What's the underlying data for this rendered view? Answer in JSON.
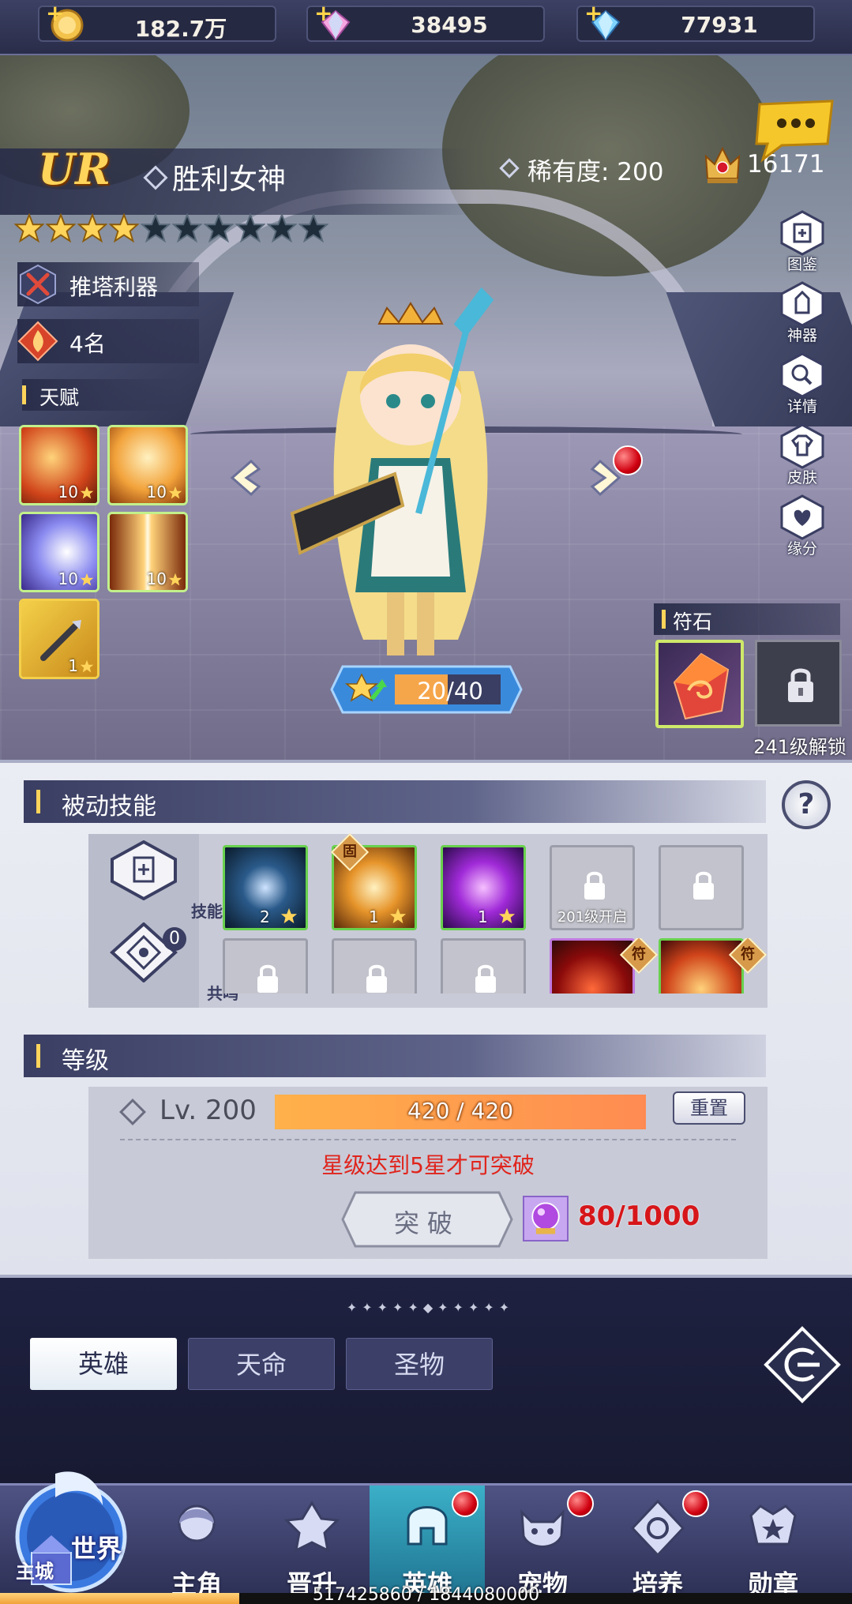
{
  "currency": {
    "gold": "182.7万",
    "gems_pink": "38495",
    "gems_blue": "77931"
  },
  "hero": {
    "grade": "UR",
    "name": "胜利女神",
    "rarity_label": "稀有度: 200",
    "power": "16171",
    "stars_filled": 4,
    "stars_total": 10,
    "role_tag": "推塔利器",
    "rank_tag": "4名"
  },
  "talent": {
    "title": "天赋",
    "items": [
      {
        "level": "10"
      },
      {
        "level": "10"
      },
      {
        "level": "10"
      },
      {
        "level": "10"
      },
      {
        "level": "1"
      }
    ]
  },
  "side_menu": [
    "图鉴",
    "神器",
    "详情",
    "皮肤",
    "缘分"
  ],
  "exp_pill": "20/40",
  "rune": {
    "title": "符石",
    "unlock_text": "241级解锁"
  },
  "passive": {
    "title": "被动技能",
    "help": "?",
    "codex_label": "技能图鉴",
    "resonance_label": "共鸣",
    "resonance_count": "0",
    "row1": [
      {
        "level": "2"
      },
      {
        "level": "1",
        "tag": "固"
      },
      {
        "level": "1"
      },
      {
        "unlock": "201级开启"
      },
      {
        "locked": true
      }
    ],
    "row2_tags": [
      "符",
      "符"
    ]
  },
  "level": {
    "title": "等级",
    "label": "Lv. 200",
    "xp": "420 / 420",
    "xp_fraction": 1.0,
    "reset": "重置",
    "hint": "星级达到5星才可突破",
    "break_button": "突破",
    "break_cost": "80/1000"
  },
  "tabs": {
    "hero": "英雄",
    "destiny": "天命",
    "relic": "圣物"
  },
  "nav": {
    "world": "世界",
    "city": "主城",
    "items": [
      {
        "label": "主角",
        "dot": false
      },
      {
        "label": "晋升",
        "dot": false
      },
      {
        "label": "英雄",
        "dot": true
      },
      {
        "label": "宠物",
        "dot": true
      },
      {
        "label": "培养",
        "dot": true
      },
      {
        "label": "勋章",
        "dot": false
      }
    ]
  },
  "account_exp": {
    "text": "517425860 / 1844080000",
    "fraction": 0.2806
  },
  "colors": {
    "accent_gold": "#ffd45a",
    "alert_red": "#e0241c",
    "active_tab": "#1d6e8c"
  }
}
